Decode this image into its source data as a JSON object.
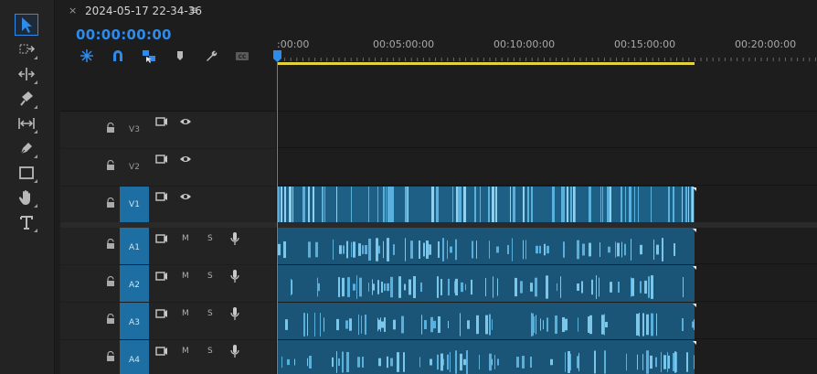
{
  "sequence": {
    "tab_close": "×",
    "tab_title": "2024-05-17 22-34-36",
    "tab_menu": "≡",
    "timecode": "00:00:00:00"
  },
  "ruler": {
    "labels": [
      ":00:00",
      "00:05:00:00",
      "00:10:00:00",
      "00:15:00:00",
      "00:20:00:00"
    ]
  },
  "tools": [
    {
      "name": "selection-tool-icon",
      "active": true
    },
    {
      "name": "track-select-forward-tool-icon",
      "active": false
    },
    {
      "name": "ripple-edit-tool-icon",
      "active": false
    },
    {
      "name": "razor-tool-icon",
      "active": false
    },
    {
      "name": "slip-tool-icon",
      "active": false
    },
    {
      "name": "pen-tool-icon",
      "active": false
    },
    {
      "name": "rectangle-tool-icon",
      "active": false
    },
    {
      "name": "hand-tool-icon",
      "active": false
    },
    {
      "name": "type-tool-icon",
      "active": false
    }
  ],
  "controls": [
    {
      "name": "nest-sequence-icon"
    },
    {
      "name": "snap-magnet-icon"
    },
    {
      "name": "linked-selection-icon"
    },
    {
      "name": "add-marker-icon"
    },
    {
      "name": "timeline-settings-wrench-icon"
    },
    {
      "name": "captions-icon"
    }
  ],
  "tracks": {
    "video": [
      {
        "id": "V3",
        "label": "V3",
        "targeted": false
      },
      {
        "id": "V2",
        "label": "V2",
        "targeted": false
      },
      {
        "id": "V1",
        "label": "V1",
        "targeted": true
      }
    ],
    "audio": [
      {
        "id": "A1",
        "label": "A1",
        "mute": "M",
        "solo": "S",
        "targeted": true
      },
      {
        "id": "A2",
        "label": "A2",
        "mute": "M",
        "solo": "S",
        "targeted": true
      },
      {
        "id": "A3",
        "label": "A3",
        "mute": "M",
        "solo": "S",
        "targeted": true
      },
      {
        "id": "A4",
        "label": "A4",
        "mute": "M",
        "solo": "S",
        "targeted": true
      }
    ]
  },
  "colors": {
    "accent": "#2d8ceb",
    "clip": "#5ab0dc",
    "clip_dark": "#1e5f85",
    "work_area": "#e3d23c",
    "track_target": "#1d6ea3"
  }
}
